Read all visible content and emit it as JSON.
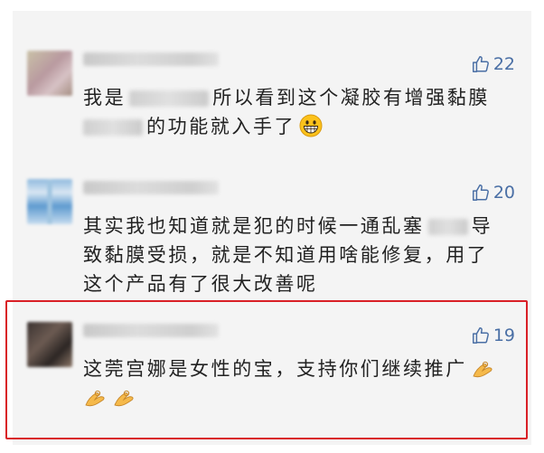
{
  "comments": [
    {
      "likes": "22",
      "lines": [
        {
          "before": "我是",
          "after": "所以看到这个凝胶有增强黏膜"
        },
        {
          "before": "",
          "after": "的功能就入手了"
        }
      ],
      "emoji": "grinning-face-emoji"
    },
    {
      "likes": "20",
      "lines": [
        {
          "before": "其实我也知道就是犯的时候一通乱塞",
          "after": "导"
        },
        {
          "before": "致黏膜受损，就是不知道用啥能修复，用了",
          "after": ""
        },
        {
          "before": "这个产品有了很大改善呢",
          "after": ""
        }
      ]
    },
    {
      "likes": "19",
      "lines": [
        {
          "before": "这莞宫娜是女性的宝，支持你们继续推广",
          "after": ""
        }
      ],
      "emoji": "ok-hand-emoji"
    }
  ],
  "colors": {
    "like": "#4a6fa5",
    "highlight_border": "#d91f26",
    "text": "#222222"
  }
}
